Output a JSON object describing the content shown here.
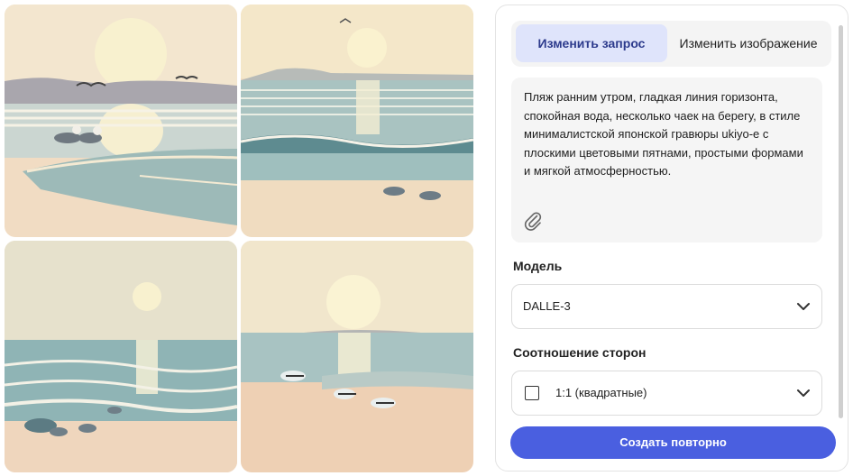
{
  "gallery": {
    "images": [
      {
        "name": "seagulls-on-shore-1"
      },
      {
        "name": "seagulls-on-shore-2"
      },
      {
        "name": "seagulls-on-shore-3"
      },
      {
        "name": "seagulls-on-shore-4"
      }
    ]
  },
  "panel": {
    "tabs": [
      {
        "label": "Изменить запрос",
        "active": true
      },
      {
        "label": "Изменить изображение",
        "active": false
      }
    ],
    "prompt_text": "Пляж ранним утром, гладкая линия горизонта, спокойная вода, несколько чаек на берегу, в стиле минималистской японской гравюры ukiyo-e с плоскими цветовыми пятнами, простыми формами и мягкой атмосферностью.",
    "model_label": "Модель",
    "model_value": "DALLE-3",
    "ratio_label": "Соотношение сторон",
    "ratio_value": "1:1 (квадратные)",
    "create_button": "Создать повторно"
  },
  "colors": {
    "accent": "#4a5fe0",
    "tab_active_bg": "#dfe4fb",
    "tab_active_text": "#2c3a8c"
  },
  "icons": [
    "paperclip-icon",
    "chevron-down-icon",
    "square-ratio-icon"
  ]
}
